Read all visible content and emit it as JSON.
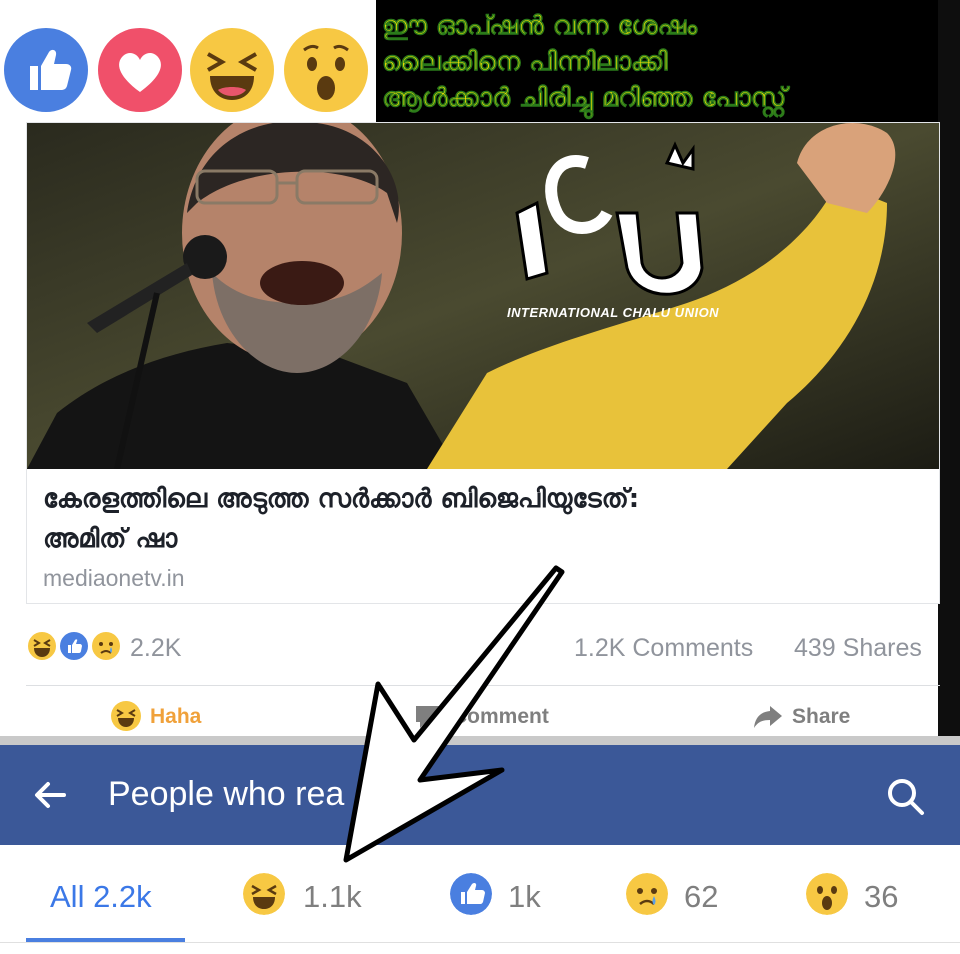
{
  "caption": {
    "lines": [
      "ഈ ഓപ്ഷൻ വന്ന ശേഷം",
      "ലൈക്കിനെ പിന്നിലാക്കി",
      "ആൾക്കാർ ചിരിച്ചു മറിഞ്ഞ പോസ്റ്റ്"
    ]
  },
  "reaction_strip": {
    "icons": [
      "like-icon",
      "love-icon",
      "haha-icon",
      "wow-icon"
    ]
  },
  "card": {
    "watermark_subtitle": "INTERNATIONAL CHALU UNION",
    "headline_line1": "കേരളത്തിലെ അടുത്ത സർക്കാർ ബിജെപിയുടേത്:",
    "headline_line2": "അമിത് ഷാ",
    "domain": "mediaonetv.in"
  },
  "summary": {
    "reaction_count": "2.2K",
    "comments": "1.2K Comments",
    "shares": "439 Shares"
  },
  "actions": {
    "haha_label": "Haha",
    "comment_label": "Comment",
    "share_label": "Share"
  },
  "people_header": {
    "title": "People who rea"
  },
  "tabs": {
    "all": "All 2.2k",
    "haha": "1.1k",
    "like": "1k",
    "sad": "62",
    "wow": "36"
  },
  "colors": {
    "facebook_blue": "#3b5898",
    "like_blue": "#4a7fe0",
    "love_red": "#f0506a",
    "emoji_yellow": "#f7c843",
    "caption_yellow": "#ffe300",
    "active_tab": "#3b78e7"
  }
}
